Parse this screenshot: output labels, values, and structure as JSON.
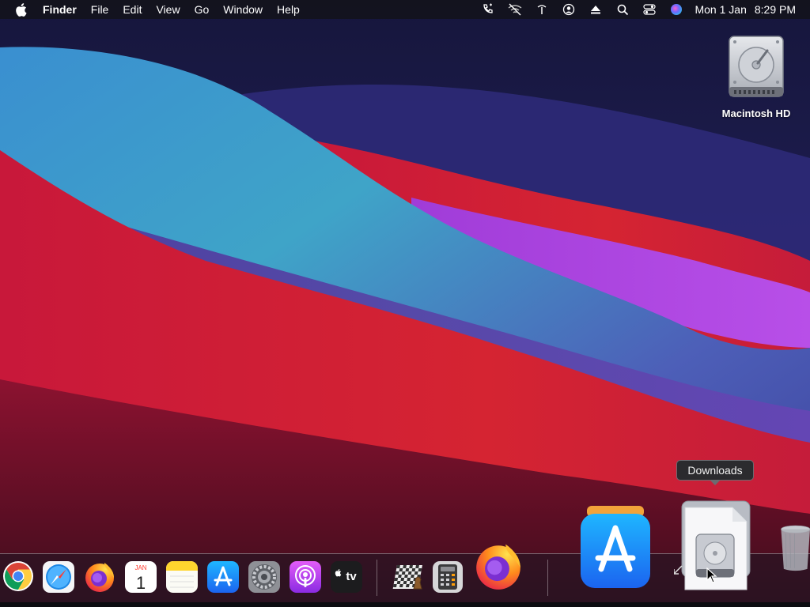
{
  "menubar": {
    "apple_icon": "apple-logo-icon",
    "app_name": "Finder",
    "items": [
      "File",
      "Edit",
      "View",
      "Go",
      "Window",
      "Help"
    ],
    "status_icons": [
      "phone-icon",
      "wifi-off-icon",
      "antenna-icon",
      "user-icon",
      "eject-icon",
      "search-icon",
      "control-center-icon",
      "siri-icon"
    ],
    "clock_date": "Mon 1 Jan",
    "clock_time": "8:29 PM"
  },
  "desktop": {
    "icons": [
      {
        "label": "Macintosh HD",
        "icon": "hard-drive-icon"
      }
    ]
  },
  "tooltip": {
    "text": "Downloads"
  },
  "dock": {
    "apps": [
      {
        "name": "Google Chrome",
        "icon": "chrome-icon"
      },
      {
        "name": "Safari",
        "icon": "safari-icon"
      },
      {
        "name": "Firefox",
        "icon": "firefox-icon"
      },
      {
        "name": "Calendar",
        "icon": "calendar-icon",
        "month": "JAN",
        "day": "1"
      },
      {
        "name": "Notes",
        "icon": "notes-icon"
      },
      {
        "name": "App Store",
        "icon": "app-store-icon"
      },
      {
        "name": "System Preferences",
        "icon": "system-preferences-icon"
      },
      {
        "name": "Podcasts",
        "icon": "podcasts-icon"
      },
      {
        "name": "TV",
        "icon": "apple-tv-icon",
        "label": "tv"
      },
      {
        "name": "Chess",
        "icon": "chess-icon"
      },
      {
        "name": "Calculator",
        "icon": "calculator-icon"
      },
      {
        "name": "Firefox",
        "icon": "firefox-icon"
      },
      {
        "name": "App Store",
        "icon": "app-store-icon"
      },
      {
        "name": "Downloads",
        "icon": "downloads-stack-icon"
      },
      {
        "name": "Trash",
        "icon": "trash-icon"
      }
    ]
  },
  "colors": {
    "wallpaper_top": "#1b1a4a",
    "wave_blue": "#3fa0c8",
    "wave_red": "#d0203a",
    "wave_purple": "#b34ae0",
    "menubar": "#14141c"
  }
}
